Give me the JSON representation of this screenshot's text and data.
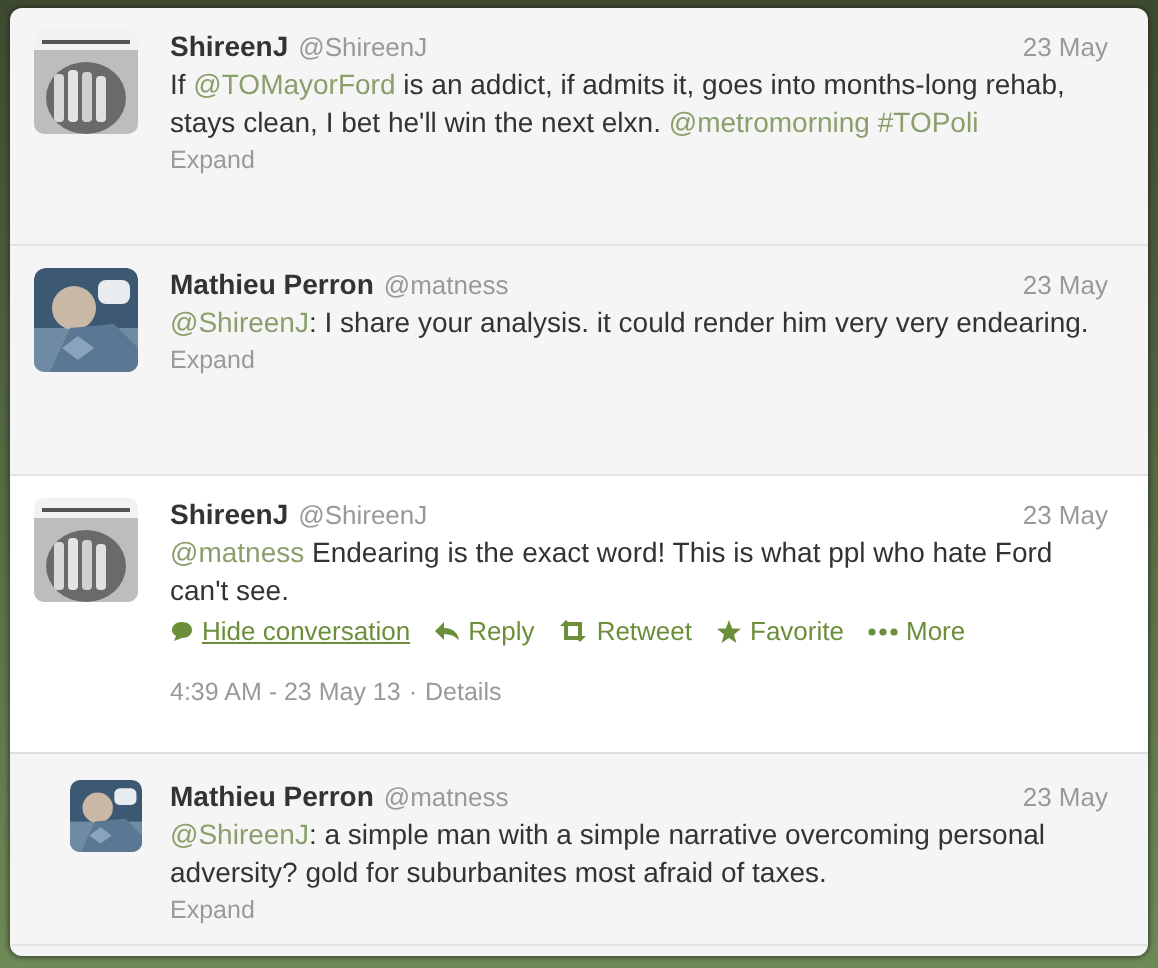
{
  "tweets": [
    {
      "kind": "tweet",
      "name": "ShireenJ",
      "handle": "@ShireenJ",
      "date": "23 May",
      "text": [
        {
          "text": "If "
        },
        {
          "text": "@TOMayorFord",
          "link": true
        },
        {
          "text": " is an addict, if admits it, goes into months-long rehab, stays clean, I bet he'll win the next elxn. "
        },
        {
          "text": "@metromorning",
          "link": true
        },
        {
          "text": "#TOPoli",
          "link": true
        }
      ],
      "expand": "Expand"
    },
    {
      "kind": "tweet",
      "name": "Mathieu Perron",
      "handle": "@matness",
      "date": "23 May",
      "text": [
        {
          "text": "@ShireenJ",
          "link": true
        },
        {
          "text": ": I share your analysis. it could render him very very endearing."
        }
      ],
      "expand": "Expand"
    },
    {
      "kind": "expanded",
      "name": "ShireenJ",
      "handle": "@ShireenJ",
      "date": "23 May",
      "text": [
        {
          "text": "@matness",
          "link": true
        },
        {
          "text": " Endearing is the exact word! This is what ppl who hate Ford can't see."
        }
      ],
      "actions": [
        "Hide conversation",
        "Reply",
        "Retweet",
        "Favorite",
        "More"
      ],
      "timestamp": "4:39 AM - 23 May 13",
      "separator": "·",
      "details": "Details"
    },
    {
      "kind": "reply",
      "name": "Mathieu Perron",
      "handle": "@matness",
      "date": "23 May",
      "text": [
        {
          "text": "@ShireenJ",
          "link": true
        },
        {
          "text": ": a simple man with a simple narrative overcoming personal adversity? gold for suburbanites most afraid of taxes."
        }
      ],
      "expand": "Expand"
    }
  ]
}
